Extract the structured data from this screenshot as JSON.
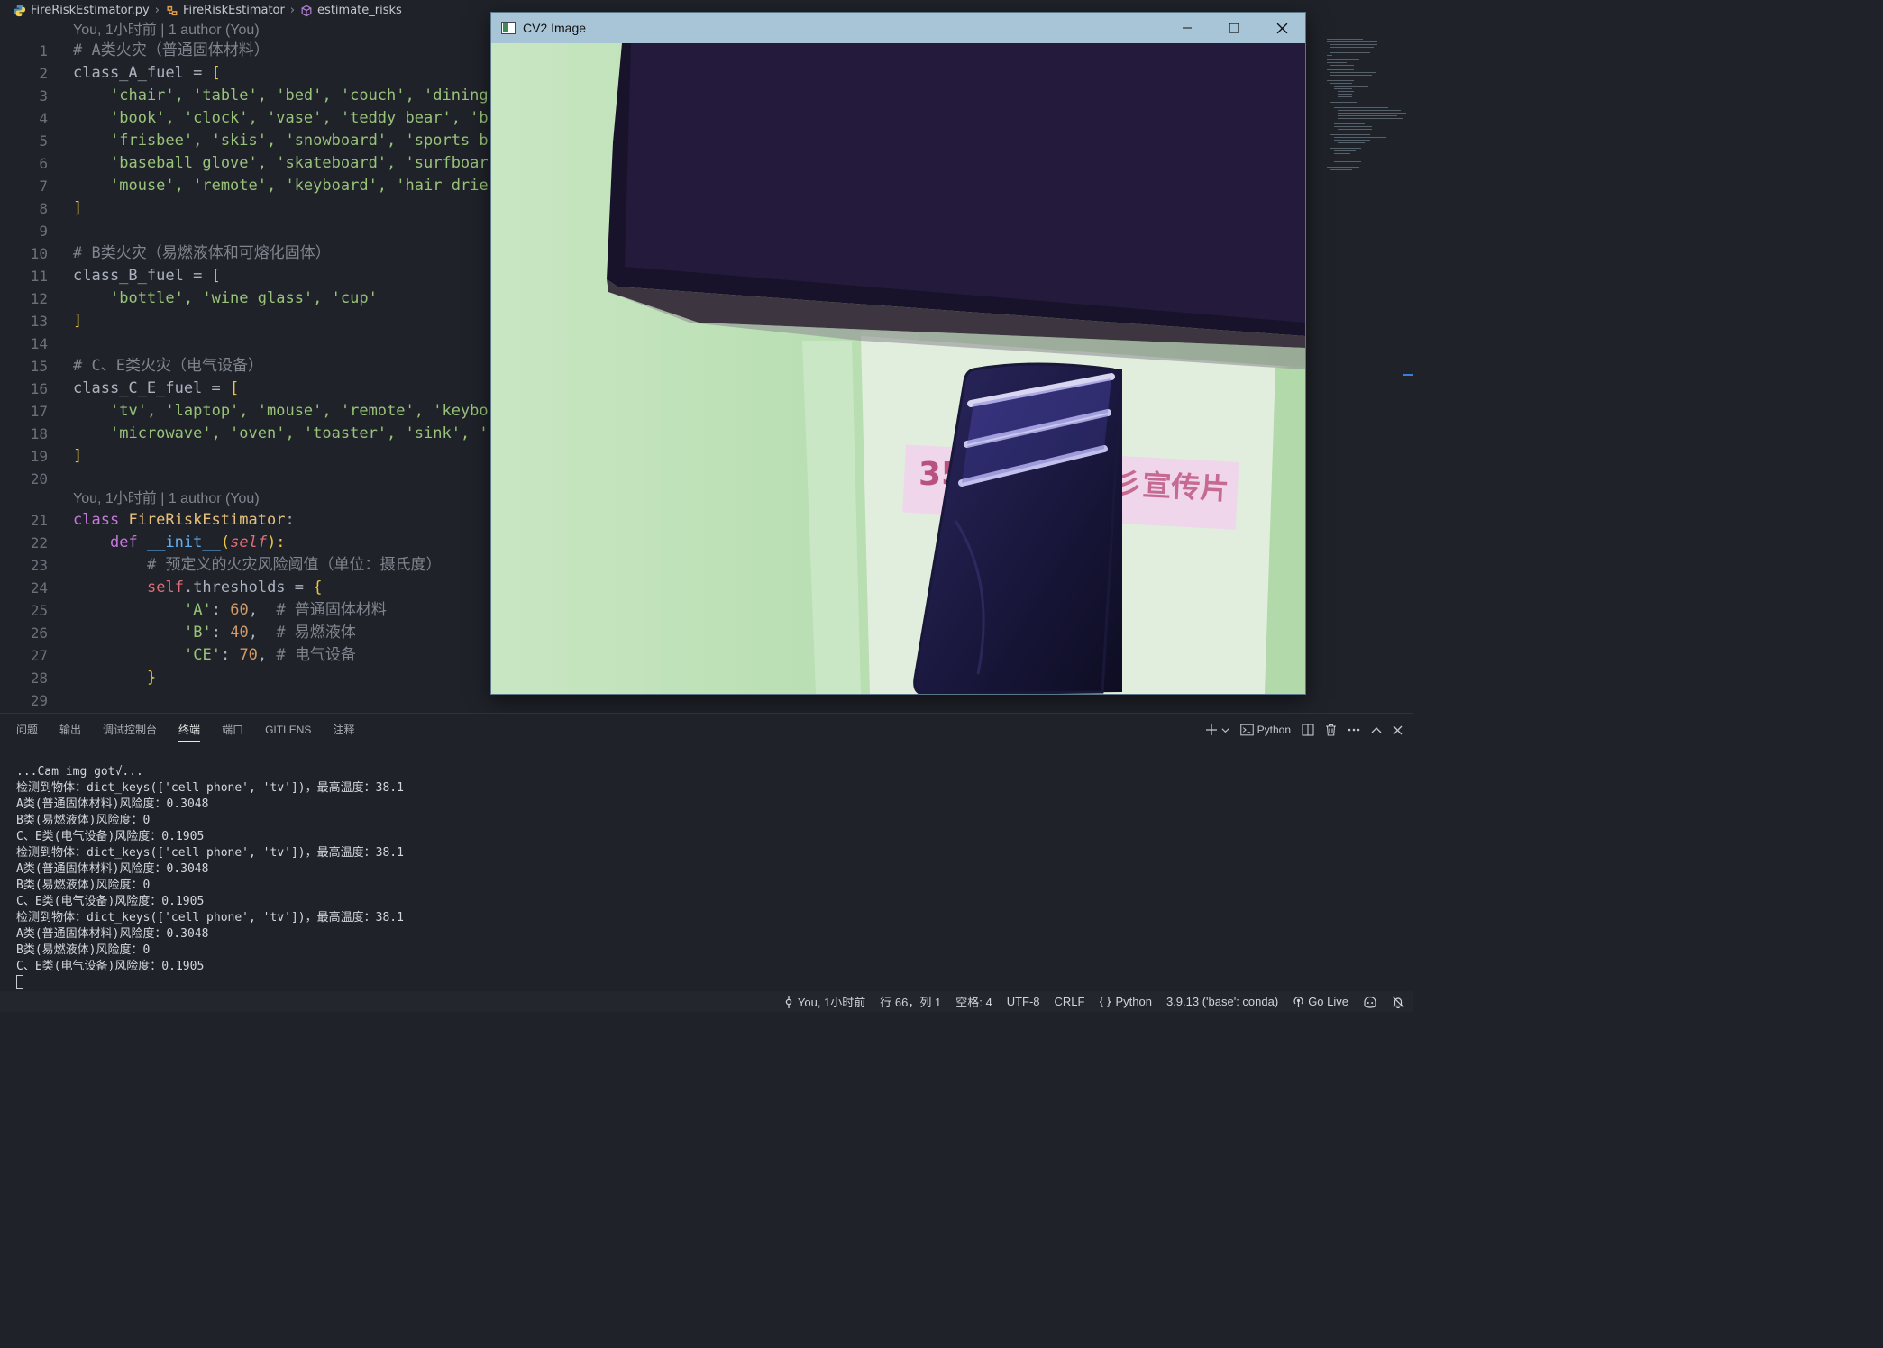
{
  "breadcrumb": {
    "file": "FireRiskEstimator.py",
    "class": "FireRiskEstimator",
    "method": "estimate_risks"
  },
  "editor": {
    "blame1": "You, 1小时前 | 1 author (You)",
    "blame2": "You, 1小时前 | 1 author (You)",
    "line_numbers": [
      "1",
      "2",
      "3",
      "4",
      "5",
      "6",
      "7",
      "8",
      "9",
      "10",
      "11",
      "12",
      "13",
      "14",
      "15",
      "16",
      "17",
      "18",
      "19",
      "20",
      "21",
      "22",
      "23",
      "24",
      "25",
      "26",
      "27",
      "28",
      "29"
    ],
    "lines": {
      "l1": "# A类火灾（普通固体材料）",
      "l2_name": "class_A_fuel",
      "l2_op": " = ",
      "l2_br": "[",
      "l3": "'chair', 'table', 'bed', 'couch', 'dining",
      "l4": "'book', 'clock', 'vase', 'teddy bear', 'b",
      "l5": "'frisbee', 'skis', 'snowboard', 'sports b",
      "l6": "'baseball glove', 'skateboard', 'surfboar",
      "l7": "'mouse', 'remote', 'keyboard', 'hair drie",
      "l8": "]",
      "l10": "# B类火灾（易燃液体和可熔化固体）",
      "l11_name": "class_B_fuel",
      "l11_op": " = ",
      "l11_br": "[",
      "l12": "'bottle', 'wine glass', 'cup'",
      "l13": "]",
      "l15": "# C、E类火灾（电气设备）",
      "l16_name": "class_C_E_fuel",
      "l16_op": " = ",
      "l16_br": "[",
      "l17": "'tv', 'laptop', 'mouse', 'remote', 'keybo",
      "l18": "'microwave', 'oven', 'toaster', 'sink', '",
      "l19": "]",
      "l21_kw": "class",
      "l21_name": "FireRiskEstimator",
      "l21_colon": ":",
      "l22_kw": "def",
      "l22_fn": "__init__",
      "l22_p1": "(",
      "l22_self": "self",
      "l22_p2": "):",
      "l23": "# 预定义的火灾风险阈值（单位：摄氏度）",
      "l24_self": "self",
      "l24_attr": ".thresholds = ",
      "l24_br": "{",
      "l25_key": "'A'",
      "l25_colon": ": ",
      "l25_val": "60",
      "l25_comma": ",  ",
      "l25_cm": "# 普通固体材料",
      "l26_key": "'B'",
      "l26_colon": ": ",
      "l26_val": "40",
      "l26_comma": ",  ",
      "l26_cm": "# 易燃液体",
      "l27_key": "'CE'",
      "l27_colon": ": ",
      "l27_val": "70",
      "l27_comma": ", ",
      "l27_cm": "# 电气设备",
      "l28": "}"
    }
  },
  "cv2_window": {
    "title": "CV2 Image",
    "label_left": "35",
    "label_right": "彡宣传片"
  },
  "panel": {
    "tabs": [
      "问题",
      "输出",
      "调试控制台",
      "终端",
      "端口",
      "GITLENS",
      "注释"
    ],
    "active_tab": "终端",
    "shell_label": "Python"
  },
  "terminal": {
    "lines": [
      "...Cam img got√...",
      "检测到物体：dict_keys(['cell phone', 'tv'])，最高温度：38.1",
      "A类(普通固体材料)风险度：0.3048",
      "B类(易燃液体)风险度：0",
      "C、E类(电气设备)风险度：0.1905",
      "检测到物体：dict_keys(['cell phone', 'tv'])，最高温度：38.1",
      "A类(普通固体材料)风险度：0.3048",
      "B类(易燃液体)风险度：0",
      "C、E类(电气设备)风险度：0.1905",
      "检测到物体：dict_keys(['cell phone', 'tv'])，最高温度：38.1",
      "A类(普通固体材料)风险度：0.3048",
      "B类(易燃液体)风险度：0",
      "C、E类(电气设备)风险度：0.1905"
    ]
  },
  "statusbar": {
    "blame": "You, 1小时前",
    "position": "行 66，列 1",
    "spaces": "空格: 4",
    "encoding": "UTF-8",
    "eol": "CRLF",
    "language": "Python",
    "interpreter": "3.9.13 ('base': conda)",
    "golive": "Go Live"
  },
  "colors": {
    "background": "#1f2229",
    "string": "#98c379",
    "keyword": "#c678dd",
    "function": "#61afef",
    "class": "#e5c07b",
    "bracket": "#e8c547",
    "number": "#d19a66",
    "self": "#e06c75",
    "comment": "#7f848e",
    "cv2_titlebar": "#a7c5d6"
  }
}
